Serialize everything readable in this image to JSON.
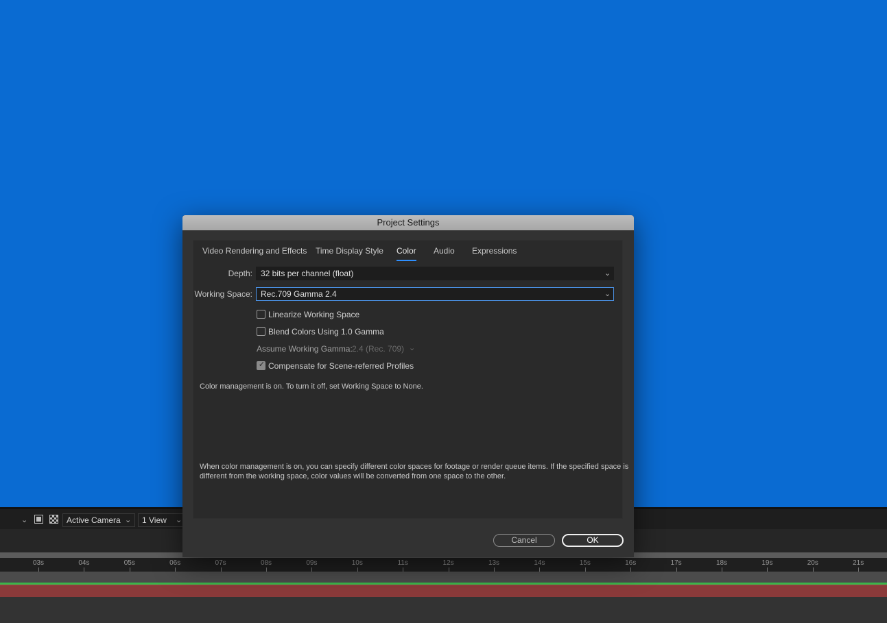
{
  "colors": {
    "viewer_background": "#0a6bd2",
    "dialog_background": "#323232",
    "accent": "#2e8fff",
    "timeline_green": "#3bb54a",
    "timeline_red": "#8b3a3a"
  },
  "viewer_toolbar": {
    "left_dropdown_icon": "chevron-down-icon",
    "region_icon": "region-of-interest-icon",
    "transparency_icon": "transparency-grid-icon",
    "camera_select": "Active Camera",
    "views_select": "1 View"
  },
  "timeline": {
    "ticks": [
      "03s",
      "04s",
      "05s",
      "06s",
      "07s",
      "08s",
      "09s",
      "10s",
      "11s",
      "12s",
      "13s",
      "14s",
      "15s",
      "16s",
      "17s",
      "18s",
      "19s",
      "20s",
      "21s"
    ]
  },
  "dialog": {
    "title": "Project Settings",
    "tabs": [
      {
        "label": "Video Rendering and Effects",
        "active": false
      },
      {
        "label": "Time Display Style",
        "active": false
      },
      {
        "label": "Color",
        "active": true
      },
      {
        "label": "Audio",
        "active": false
      },
      {
        "label": "Expressions",
        "active": false
      }
    ],
    "depth": {
      "label": "Depth:",
      "value": "32 bits per channel (float)"
    },
    "working_space": {
      "label": "Working Space:",
      "value": "Rec.709 Gamma 2.4"
    },
    "checkboxes": [
      {
        "label": "Linearize Working Space",
        "checked": false,
        "enabled": true
      },
      {
        "label": "Blend Colors Using 1.0 Gamma",
        "checked": false,
        "enabled": true
      }
    ],
    "assume_gamma": {
      "label": "Assume Working Gamma:",
      "value": "2.4 (Rec. 709)",
      "enabled": false
    },
    "compensate": {
      "label": "Compensate for Scene-referred Profiles",
      "checked": true,
      "enabled": true
    },
    "status_text": "Color management is on. To turn it off, set Working Space to None.",
    "help_text_line1": "When color management is on, you can specify different color spaces for footage or render queue items. If the specified space is",
    "help_text_line2": "different from the working space, color values will be converted from one space to the other.",
    "cancel_label": "Cancel",
    "ok_label": "OK"
  }
}
